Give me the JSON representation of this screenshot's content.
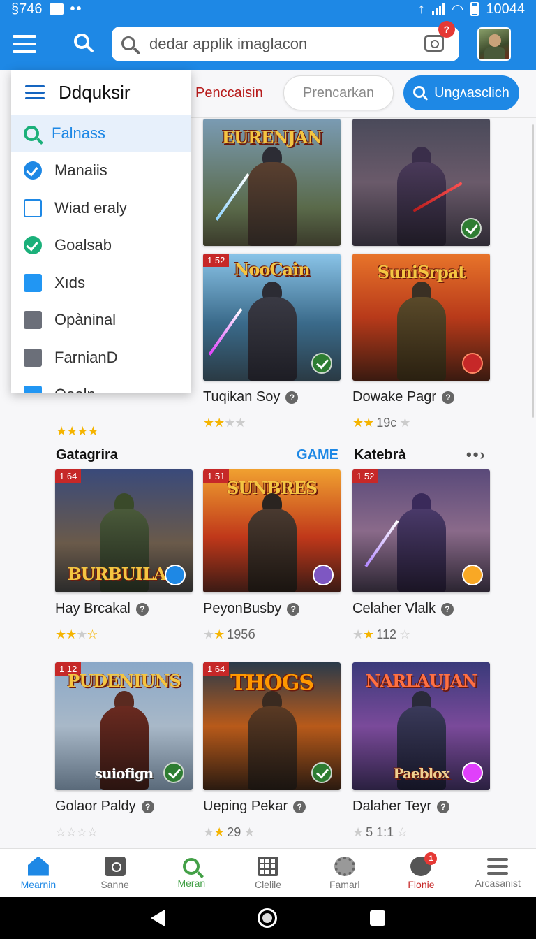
{
  "status": {
    "left_text": "§746",
    "time": "10044"
  },
  "search": {
    "placeholder": "dedar applik imaglacon",
    "camera_badge": "?"
  },
  "filters": {
    "text_option": "Penccaisin",
    "outline_option": "Prencarkan",
    "primary_button": "Ungʌasclich"
  },
  "drawer": {
    "title": "Ddquksir",
    "items": [
      {
        "label": "Falnass",
        "icon": "search-icon"
      },
      {
        "label": "Manaiis",
        "icon": "checkbox-checked-icon"
      },
      {
        "label": "Wiad eraly",
        "icon": "checkbox-empty-icon"
      },
      {
        "label": "Goalsab",
        "icon": "checkbox-green-icon"
      },
      {
        "label": "Xıds",
        "icon": "square-blue-icon"
      },
      {
        "label": "Opàninal",
        "icon": "square-gray-icon"
      },
      {
        "label": "FarnianD",
        "icon": "square-gray-icon"
      },
      {
        "label": "Qoeln ...",
        "icon": "square-blue-icon"
      }
    ]
  },
  "row1": [
    {
      "art_title": "EURENJAN"
    },
    {
      "art_title": ""
    }
  ],
  "row2": [
    {
      "tag": "1 52",
      "art_title": "NooCain",
      "name": "Tuqikan Soy",
      "rating_count": ""
    },
    {
      "tag": "",
      "art_title": "SuniSrpat",
      "name": "Dowake Pagr",
      "rating_count": "19с"
    }
  ],
  "row2_left_stars": "",
  "section": {
    "title": "Gatagrira",
    "link": "GAME",
    "title2": "Katebrà",
    "more": "••›"
  },
  "row3": [
    {
      "tag": "1 64",
      "art_title": "BURBUILAN",
      "name": "Hay Brcakal",
      "rating_count": ""
    },
    {
      "tag": "1 51",
      "art_title": "SUNBRES",
      "name": "PeyonBusby",
      "rating_count": "195б"
    },
    {
      "tag": "1 52",
      "art_title": "",
      "name": "Celaher Vlalk",
      "rating_count": "112"
    }
  ],
  "row4": [
    {
      "tag": "1 12",
      "art_title": "PUDENIUNS",
      "sub_art": "suiofign",
      "name": "Golaor Paldy",
      "rating_count": ""
    },
    {
      "tag": "1 64",
      "art_title": "THOGS",
      "sub_art": "",
      "name": "Ueping Pekar",
      "rating_count": "29"
    },
    {
      "tag": "",
      "art_title": "NARLAUJAN",
      "sub_art": "Paeblox",
      "name": "Dalaher Teyr",
      "rating_count": "5 1:1"
    }
  ],
  "bottom_nav": [
    {
      "label": "Mearnin",
      "icon": "home-icon"
    },
    {
      "label": "Sanne",
      "icon": "camera-square-icon"
    },
    {
      "label": "Meran",
      "icon": "search-icon"
    },
    {
      "label": "Clelile",
      "icon": "grid-icon"
    },
    {
      "label": "Famarl",
      "icon": "gear-icon"
    },
    {
      "label": "Flonie",
      "icon": "person-icon",
      "badge": "1"
    },
    {
      "label": "Arcasanist",
      "icon": "menu-icon"
    }
  ],
  "colors": {
    "primary": "#1e88e5",
    "danger": "#e53935",
    "success": "#1bb07a"
  }
}
